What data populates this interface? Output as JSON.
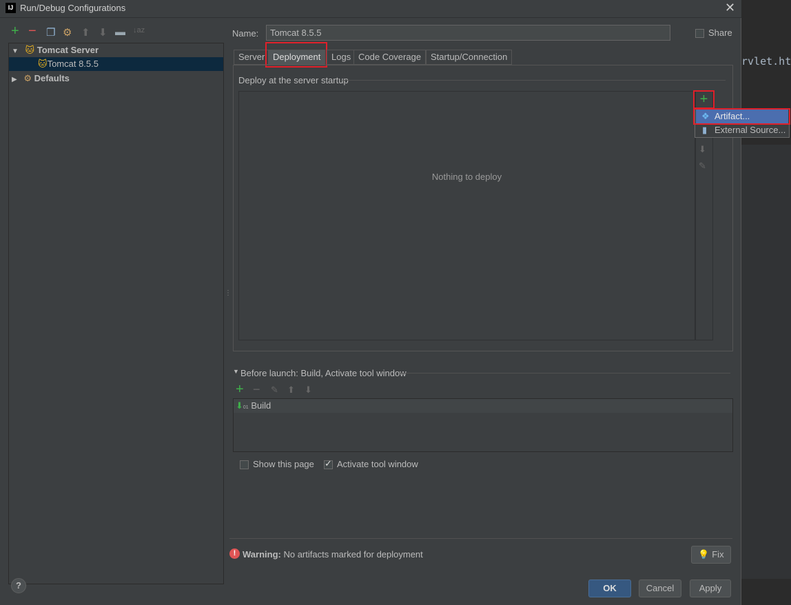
{
  "window": {
    "title": "Run/Debug Configurations",
    "logo": "IJ"
  },
  "editor": {
    "code_fragment": "rvlet.ht"
  },
  "toolbar": {
    "icons": [
      "add-icon",
      "remove-icon",
      "copy-icon",
      "wrench-icon",
      "move-up-icon",
      "move-down-icon",
      "folder-icon",
      "sort-icon"
    ]
  },
  "tree": {
    "items": [
      {
        "label": "Tomcat Server",
        "expanded": true
      },
      {
        "label": "Tomcat 8.5.5",
        "selected": true
      },
      {
        "label": "Defaults",
        "expanded": false
      }
    ]
  },
  "name": {
    "label": "Name:",
    "value": "Tomcat 8.5.5"
  },
  "share": {
    "label": "Share",
    "checked": false
  },
  "tabs": [
    "Server",
    "Deployment",
    "Logs",
    "Code Coverage",
    "Startup/Connection"
  ],
  "active_tab": "Deployment",
  "deployment": {
    "section_label": "Deploy at the server startup",
    "empty_text": "Nothing to deploy"
  },
  "popup": {
    "items": [
      "Artifact...",
      "External Source..."
    ]
  },
  "before_launch": {
    "label": "Before launch: Build, Activate tool window",
    "items": [
      "Build"
    ]
  },
  "options": {
    "show_page": {
      "label": "Show this page",
      "checked": false
    },
    "activate_tool": {
      "label": "Activate tool window",
      "checked": true
    }
  },
  "warning": {
    "bold": "Warning:",
    "text": "No artifacts marked for deployment",
    "fix_label": "Fix"
  },
  "buttons": {
    "ok": "OK",
    "cancel": "Cancel",
    "apply": "Apply",
    "help": "?"
  },
  "colors": {
    "accent": "#4b6eaf",
    "highlight": "#e0202a",
    "add": "#3fae4a",
    "warning": "#e05555"
  }
}
